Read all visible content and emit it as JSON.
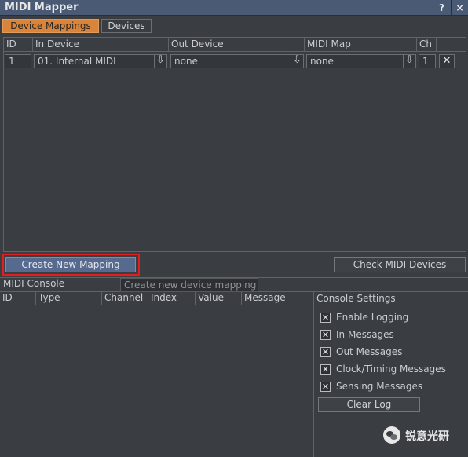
{
  "window": {
    "title": "MIDI Mapper",
    "help_label": "?",
    "close_label": "×"
  },
  "tabs": [
    {
      "label": "Device Mappings"
    },
    {
      "label": "Devices"
    }
  ],
  "mappings": {
    "columns": [
      "ID",
      "In Device",
      "Out Device",
      "MIDI Map",
      "Ch"
    ],
    "rows": [
      {
        "id": "1",
        "in_device": "01. Internal MIDI",
        "out_device": "none",
        "midi_map": "none",
        "ch": "1"
      }
    ],
    "dropdown_glyph": "⇩",
    "delete_glyph": "✕"
  },
  "buttons": {
    "create": "Create New Mapping",
    "check": "Check MIDI Devices"
  },
  "tooltip": "Create new device mapping",
  "console": {
    "title": "MIDI Console",
    "columns": [
      "ID",
      "Type",
      "Channel",
      "Index",
      "Value",
      "Message"
    ],
    "settings_title": "Console Settings",
    "settings": [
      {
        "label": "Enable Logging",
        "checked": true
      },
      {
        "label": "In Messages",
        "checked": true
      },
      {
        "label": "Out Messages",
        "checked": true
      },
      {
        "label": "Clock/Timing Messages",
        "checked": true
      },
      {
        "label": "Sensing Messages",
        "checked": true
      }
    ],
    "clear_log": "Clear Log",
    "check_glyph": "✕"
  },
  "watermark": {
    "text": "锐意光研"
  },
  "colors": {
    "accent_tab": "#d9843a",
    "highlight_box": "#e02020",
    "primary_button": "#56698f",
    "titlebar": "#4b5a74"
  }
}
